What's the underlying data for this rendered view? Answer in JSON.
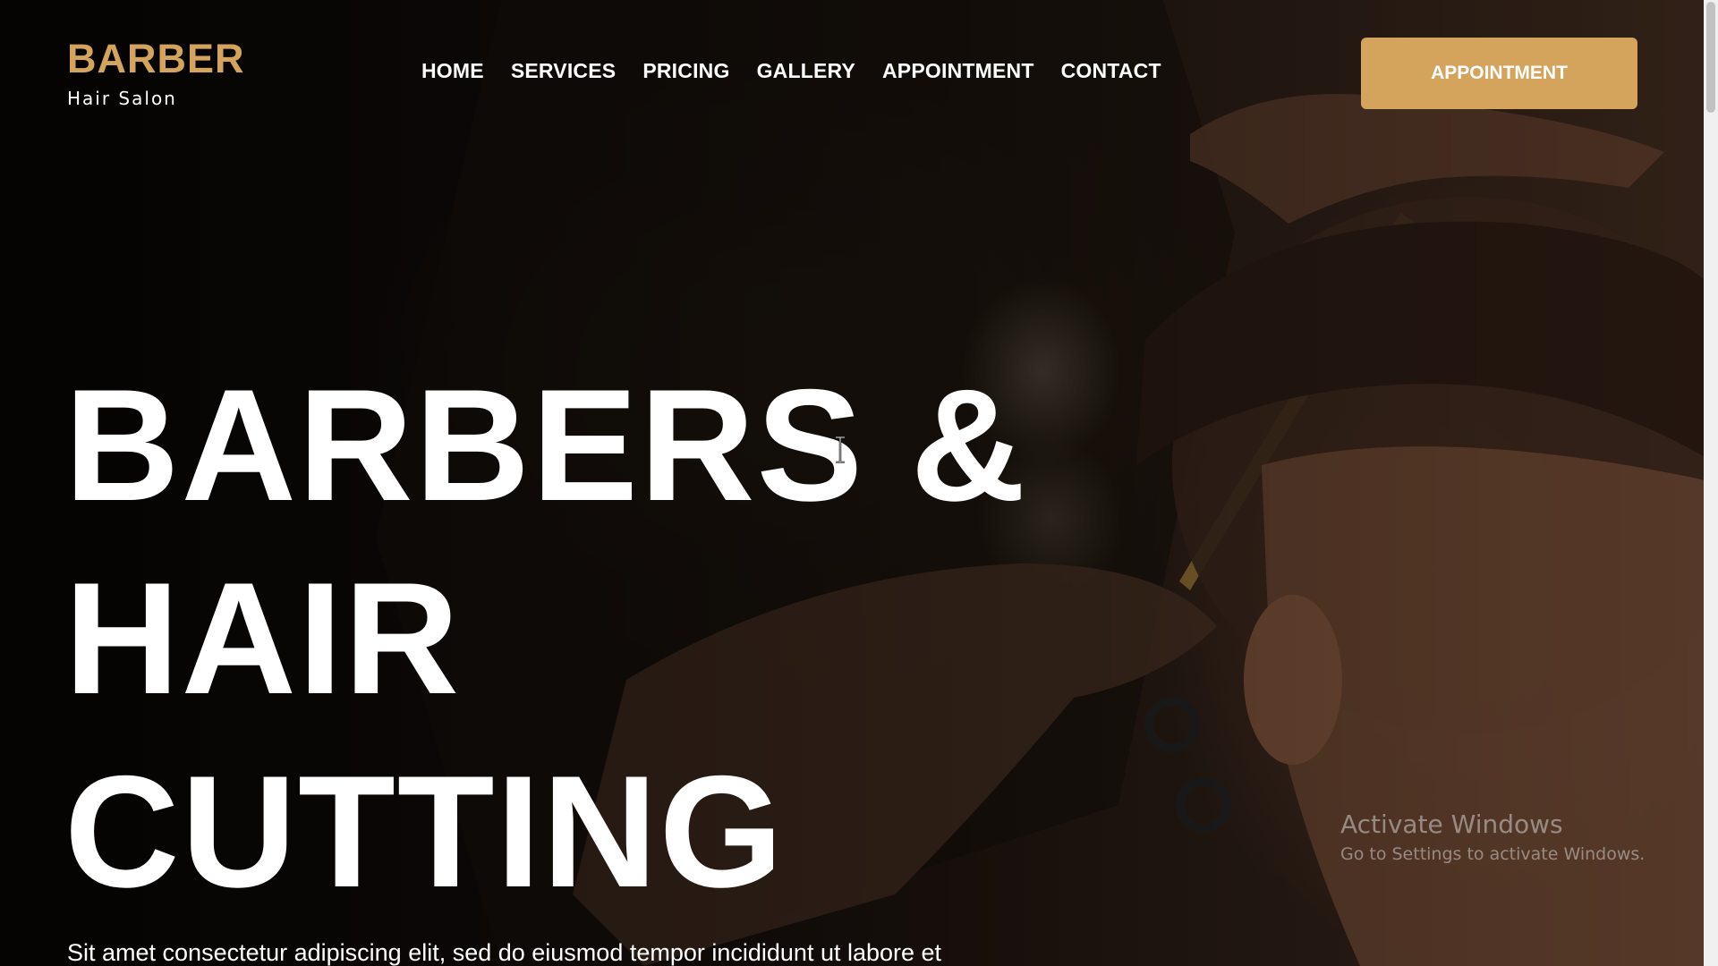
{
  "logo": {
    "title": "BARBER",
    "subtitle": "Hair Salon"
  },
  "nav": {
    "items": [
      "HOME",
      "SERVICES",
      "PRICING",
      "GALLERY",
      "APPOINTMENT",
      "CONTACT"
    ]
  },
  "header": {
    "cta_label": "APPOINTMENT"
  },
  "hero": {
    "title_lines": [
      "BARBERS &",
      "HAIR",
      "CUTTING"
    ],
    "description": "Sit amet consectetur adipiscing elit, sed do eiusmod tempor incididunt ut labore et"
  },
  "watermark": {
    "title": "Activate Windows",
    "subtitle": "Go to Settings to activate Windows."
  },
  "colors": {
    "accent": "#d4a35c",
    "text": "#ffffff",
    "background": "#0b0806"
  },
  "icons": {
    "cursor": "text-cursor-icon"
  }
}
